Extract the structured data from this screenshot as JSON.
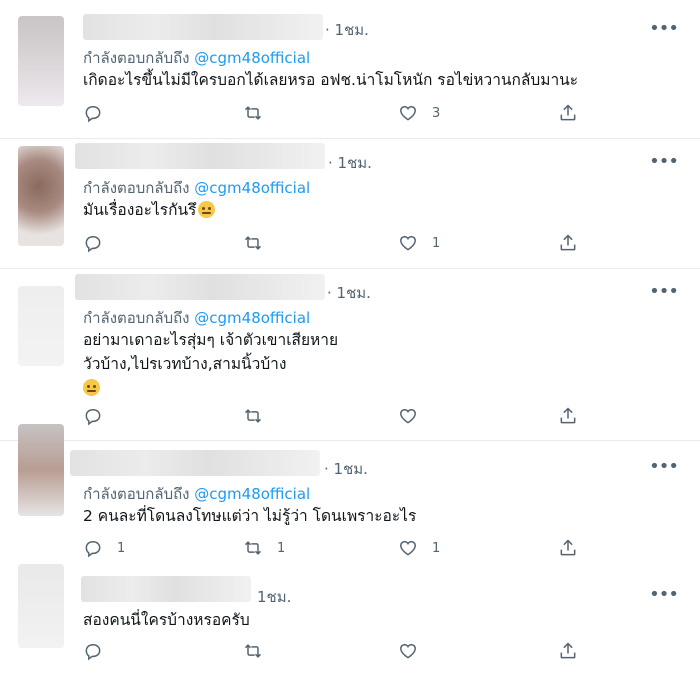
{
  "tweets": [
    {
      "time": "· 1ชม.",
      "replying_prefix": "กำลังตอบกลับถึง",
      "mention": "@cgm48official",
      "lines": [
        "เกิดอะไรขึ้นไม่มีใครบอกได้เลยหรอ อฟช.น่าโมโหนัก รอไข่หวานกลับมานะ"
      ],
      "counts": {
        "reply": "",
        "retweet": "",
        "like": "3"
      }
    },
    {
      "time": "· 1ชม.",
      "replying_prefix": "กำลังตอบกลับถึง",
      "mention": "@cgm48official",
      "lines": [
        "มันเรื่องอะไรกันรึ"
      ],
      "emoji": "thinking-emoji",
      "counts": {
        "reply": "",
        "retweet": "",
        "like": "1"
      }
    },
    {
      "time": "· 1ชม.",
      "replying_prefix": "กำลังตอบกลับถึง",
      "mention": "@cgm48official",
      "lines": [
        "อย่ามาเดาอะไรสุ่มๆ เจ้าตัวเขาเสียหาย",
        "วัวบ้าง,ไปรเวทบ้าง,สามนิ้วบ้าง"
      ],
      "emoji": "persevering-emoji",
      "counts": {
        "reply": "",
        "retweet": "",
        "like": ""
      }
    },
    {
      "time": "· 1ชม.",
      "replying_prefix": "กำลังตอบกลับถึง",
      "mention": "@cgm48official",
      "lines": [
        "2 คนละที่โดนลงโทษแต่ว่า ไม่รู้ว่า โดนเพราะอะไร"
      ],
      "counts": {
        "reply": "1",
        "retweet": "1",
        "like": "1"
      }
    },
    {
      "time": "1ชม.",
      "lines": [
        "สองคนนี่ใครบ้างหรอครับ"
      ],
      "counts": {
        "reply": "",
        "retweet": "",
        "like": ""
      }
    }
  ],
  "icons": {
    "reply": "reply-icon",
    "retweet": "retweet-icon",
    "like": "heart-icon",
    "share": "share-icon",
    "more": "more-icon"
  },
  "colors": {
    "mention": "#1d9bf0",
    "secondary": "#536471",
    "text": "#0f1419",
    "divider": "#e6ecf0"
  }
}
